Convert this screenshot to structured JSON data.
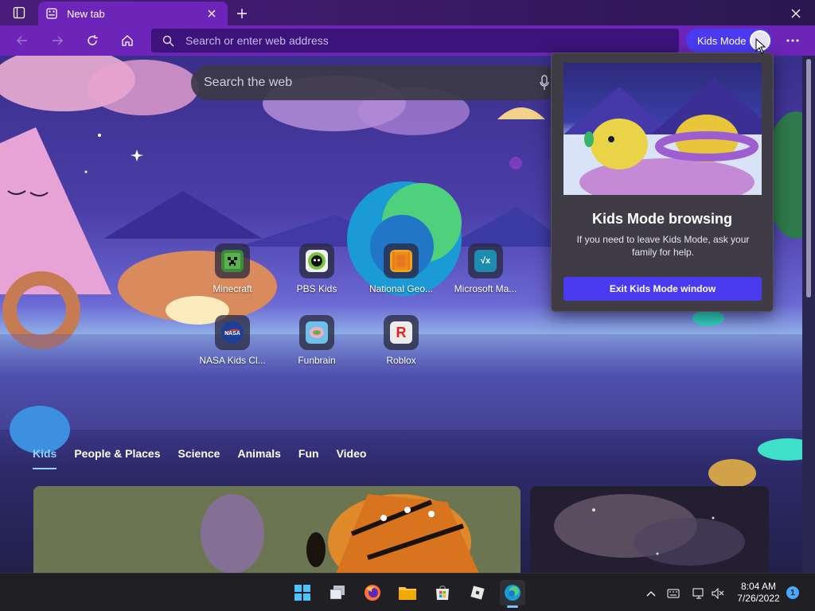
{
  "browser": {
    "tab": {
      "title": "New tab"
    },
    "address_bar": {
      "placeholder": "Search or enter web address"
    },
    "kids_mode_button": {
      "label": "Kids Mode"
    }
  },
  "page": {
    "search": {
      "placeholder": "Search the web"
    },
    "quick_links": [
      {
        "name": "Minecraft",
        "icon": "minecraft-icon",
        "color": "#3c8a3c"
      },
      {
        "name": "PBS Kids",
        "icon": "pbs-kids-icon",
        "color": "#eff2f0"
      },
      {
        "name": "National Geo...",
        "icon": "national-geographic-icon",
        "color": "#f0a21b"
      },
      {
        "name": "Microsoft Ma...",
        "icon": "microsoft-math-icon",
        "color": "#1f8bb0"
      },
      {
        "name": "NASA Kids Cl...",
        "icon": "nasa-icon",
        "color": "#1d3f94"
      },
      {
        "name": "Funbrain",
        "icon": "funbrain-icon",
        "color": "#6fc0e8"
      },
      {
        "name": "Roblox",
        "icon": "roblox-icon",
        "color": "#ececec"
      }
    ],
    "categories": [
      "Kids",
      "People & Places",
      "Science",
      "Animals",
      "Fun",
      "Video"
    ],
    "active_category": "Kids"
  },
  "flyout": {
    "title": "Kids Mode browsing",
    "description": "If you need to leave Kids Mode, ask your family for help.",
    "button": "Exit Kids Mode window"
  },
  "taskbar": {
    "apps": [
      "windows-start-icon",
      "task-view-icon",
      "firefox-icon",
      "file-explorer-icon",
      "microsoft-store-icon",
      "roblox-icon",
      "edge-icon"
    ],
    "time": "8:04 AM",
    "date": "7/26/2022",
    "notification_count": "1"
  },
  "colors": {
    "accent": "#6c25b8",
    "kids_button": "#4a3bf0"
  }
}
